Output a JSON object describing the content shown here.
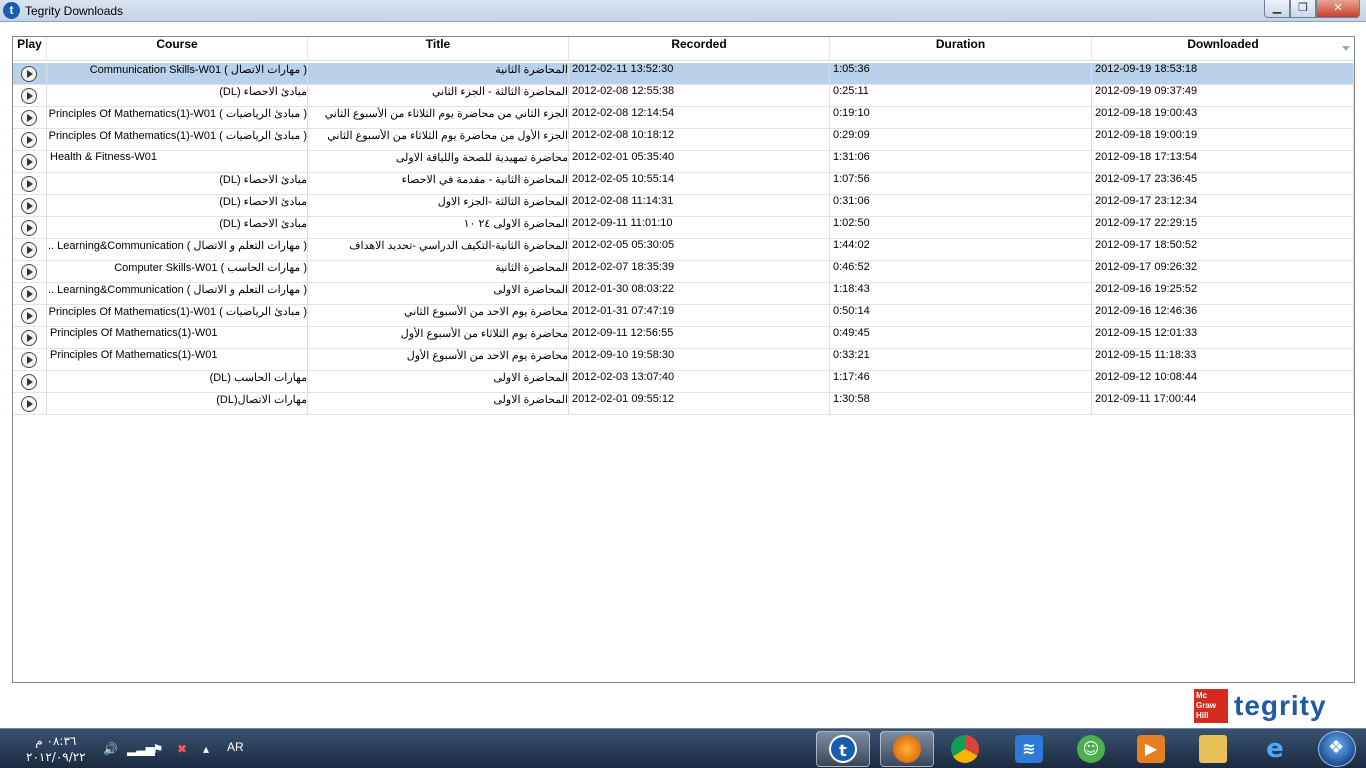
{
  "window": {
    "title": "Tegrity Downloads"
  },
  "columns": [
    "Play",
    "Course",
    "Title",
    "Recorded",
    "Duration",
    "Downloaded"
  ],
  "rows": [
    {
      "course": "( مهارات الاتصال ) Communication Skills-W01",
      "title": "المحاضرة الثانية",
      "recorded": "2012-02-11 13:52:30",
      "duration": "1:05:36",
      "downloaded": "2012-09-19 18:53:18"
    },
    {
      "course": "مبادئ الاحصاء (DL)",
      "title": "المحاضرة الثالثة - الجزء الثاني",
      "recorded": "2012-02-08 12:55:38",
      "duration": "0:25:11",
      "downloaded": "2012-09-19 09:37:49"
    },
    {
      "course": "( مبادئ الرياضيات ) Principles Of Mathematics(1)-W01",
      "title": "الجزء الثاني من محاضرة يوم الثلاثاء من الأسبوع الثاني",
      "recorded": "2012-02-08 12:14:54",
      "duration": "0:19:10",
      "downloaded": "2012-09-18 19:00:43"
    },
    {
      "course": "( مبادئ الرياضيات ) Principles Of Mathematics(1)-W01",
      "title": "الجزء الأول من محاضرة يوم الثلاثاء من الأسبوع الثاني",
      "recorded": "2012-02-08 10:18:12",
      "duration": "0:29:09",
      "downloaded": "2012-09-18 19:00:19"
    },
    {
      "course": "Health & Fitness-W01",
      "title": "محاضرة تمهيدية للصحة واللياقة الاولى",
      "recorded": "2012-02-01 05:35:40",
      "duration": "1:31:06",
      "downloaded": "2012-09-18 17:13:54"
    },
    {
      "course": "مبادئ الاحصاء (DL)",
      "title": "المحاضرة الثانية - مقدمة في الاحصاء",
      "recorded": "2012-02-05 10:55:14",
      "duration": "1:07:56",
      "downloaded": "2012-09-17 23:36:45"
    },
    {
      "course": "مبادئ الاحصاء (DL)",
      "title": "المحاضرة الثالثة -الجزء الاول",
      "recorded": "2012-02-08 11:14:31",
      "duration": "0:31:06",
      "downloaded": "2012-09-17 23:12:34"
    },
    {
      "course": "مبادئ الاحصاء (DL)",
      "title": "المحاضرة الاولى ٢٤ ١٠",
      "recorded": "2012-09-11 11:01:10",
      "duration": "1:02:50",
      "downloaded": "2012-09-17 22:29:15"
    },
    {
      "course": "( مهارات التعلم و الاتصال ) Learning&Communication ...",
      "title": "المحاضرة الثانية-التكيف الدراسي -تحديد الاهداف",
      "recorded": "2012-02-05 05:30:05",
      "duration": "1:44:02",
      "downloaded": "2012-09-17 18:50:52"
    },
    {
      "course": "( مهارات الحاسب ) Computer Skills-W01",
      "title": "المحاضرة الثانية",
      "recorded": "2012-02-07 18:35:39",
      "duration": "0:46:52",
      "downloaded": "2012-09-17 09:26:32"
    },
    {
      "course": "( مهارات التعلم و الاتصال ) Learning&Communication ...",
      "title": "المحاضرة الاولى",
      "recorded": "2012-01-30 08:03:22",
      "duration": "1:18:43",
      "downloaded": "2012-09-16 19:25:52"
    },
    {
      "course": "( مبادئ الرياضيات ) Principles Of Mathematics(1)-W01",
      "title": "محاضرة يوم الاحد من الأسبوع الثاني",
      "recorded": "2012-01-31 07:47:19",
      "duration": "0:50:14",
      "downloaded": "2012-09-16 12:46:36"
    },
    {
      "course": "Principles Of Mathematics(1)-W01",
      "title": "محاضرة يوم الثلاثاء من الأسبوع الأول",
      "recorded": "2012-09-11 12:56:55",
      "duration": "0:49:45",
      "downloaded": "2012-09-15 12:01:33"
    },
    {
      "course": "Principles Of Mathematics(1)-W01",
      "title": "محاضرة يوم الاحد من الأسبوع الأول",
      "recorded": "2012-09-10 19:58:30",
      "duration": "0:33:21",
      "downloaded": "2012-09-15 11:18:33"
    },
    {
      "course": "مهارات الحاسب (DL)",
      "title": "المحاضرة الاولى",
      "recorded": "2012-02-03 13:07:40",
      "duration": "1:17:46",
      "downloaded": "2012-09-12 10:08:44"
    },
    {
      "course": "مهارات الاتصال(DL)",
      "title": "المحاضرة الاولى",
      "recorded": "2012-02-01 09:55:12",
      "duration": "1:30:58",
      "downloaded": "2012-09-11 17:00:44"
    }
  ],
  "selected_row": 0,
  "logo": {
    "brand_top": "Mc",
    "brand_mid": "Graw",
    "brand_bot": "Hill",
    "product": "tegrity"
  },
  "taskbar": {
    "time": "٠٨:٣٦ م",
    "date": "٢٠١٢/٠٩/٢٢",
    "language": "AR"
  },
  "colors": {
    "selected_row": "#b9d1ea",
    "tegrity_blue": "#1f5aa3",
    "mcgraw_red": "#d52b1e"
  }
}
